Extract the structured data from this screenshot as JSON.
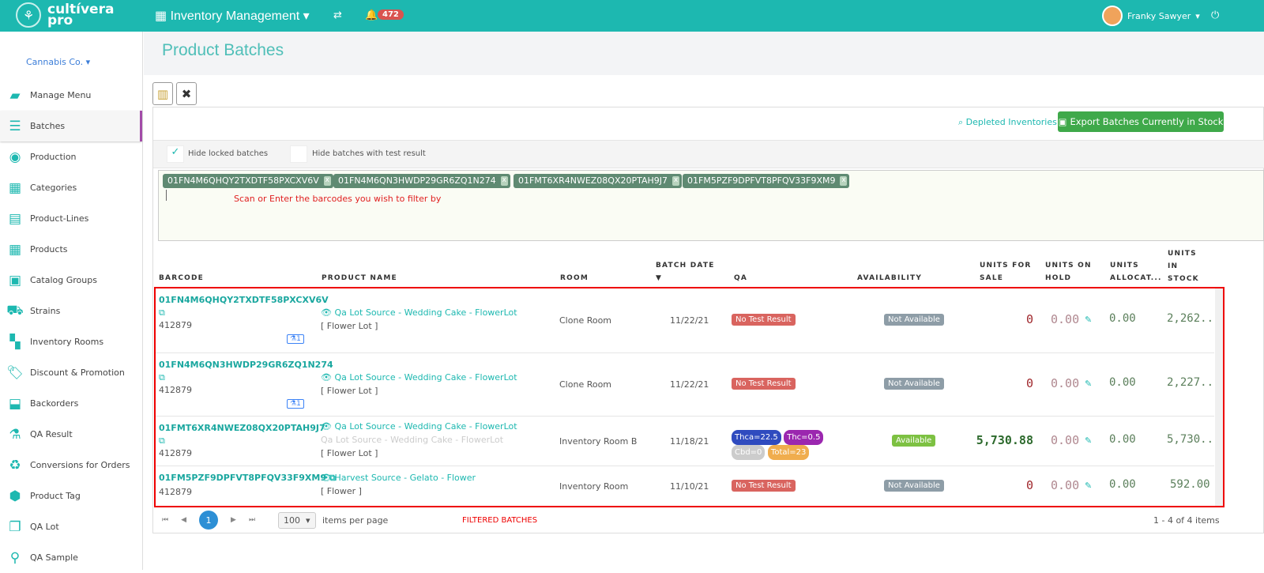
{
  "header": {
    "brand_line1": "cultívera",
    "brand_line2": "pro",
    "app_title": "Inventory Management",
    "notifications": "472",
    "user": "Franky Sawyer"
  },
  "sidebar": {
    "company": "Cannabis Co.",
    "items": [
      {
        "label": "Manage Menu",
        "icon": "▰"
      },
      {
        "label": "Batches",
        "icon": "☰"
      },
      {
        "label": "Production",
        "icon": "◉"
      },
      {
        "label": "Categories",
        "icon": "▦"
      },
      {
        "label": "Product-Lines",
        "icon": "▤"
      },
      {
        "label": "Products",
        "icon": "▦"
      },
      {
        "label": "Catalog Groups",
        "icon": "▣"
      },
      {
        "label": "Strains",
        "icon": "⛟"
      },
      {
        "label": "Inventory Rooms",
        "icon": "▚"
      },
      {
        "label": "Discount & Promotion",
        "icon": "🏷"
      },
      {
        "label": "Backorders",
        "icon": "⬓"
      },
      {
        "label": "QA Result",
        "icon": "⚗"
      },
      {
        "label": "Conversions for Orders",
        "icon": "♻"
      },
      {
        "label": "Product Tag",
        "icon": "⬢"
      },
      {
        "label": "QA Lot",
        "icon": "❐"
      },
      {
        "label": "QA Sample",
        "icon": "⚲"
      }
    ]
  },
  "page": {
    "title": "Product Batches",
    "depleted": "Depleted Inventories",
    "export": "Export Batches Currently in Stock",
    "hide_locked": "Hide locked batches",
    "hide_tested": "Hide batches with test result",
    "hint": "Scan or Enter the barcodes you wish to filter by",
    "tags": [
      "01FN4M6QHQY2TXDTF58PXCXV6V",
      "01FN4M6QN3HWDP29GR6ZQ1N274",
      "01FMT6XR4NWEZ08QX20PTAH9J7",
      "01FM5PZF9DPFVT8PFQV33F9XM9"
    ]
  },
  "table": {
    "headers": {
      "barcode": "BARCODE",
      "product": "PRODUCT NAME",
      "room": "ROOM",
      "date1": "BATCH DATE",
      "date2": "▼",
      "qa": "QA",
      "avail": "AVAILABILITY",
      "sale1": "UNITS FOR",
      "sale2": "SALE",
      "hold1": "UNITS ON",
      "hold2": "HOLD",
      "alloc1": "UNITS",
      "alloc2": "ALLOCAT...",
      "stock1": "UNITS",
      "stock2": "IN",
      "stock3": "STOCK"
    },
    "rows": [
      {
        "barcode": "01FN4M6QHQY2TXDTF58PXCXV6V",
        "id": "412879",
        "qa_count": "1",
        "product": "Qa Lot Source - Wedding Cake - FlowerLot",
        "sub": "",
        "type": "[ Flower Lot ]",
        "room": "Clone Room",
        "date": "11/22/21",
        "qa": "No Test Result",
        "avail": "Not Available",
        "sale": "0",
        "hold": "0.00",
        "alloc": "0.00",
        "stock": "2,262...."
      },
      {
        "barcode": "01FN4M6QN3HWDP29GR6ZQ1N274",
        "id": "412879",
        "qa_count": "1",
        "product": "Qa Lot Source - Wedding Cake - FlowerLot",
        "sub": "",
        "type": "[ Flower Lot ]",
        "room": "Clone Room",
        "date": "11/22/21",
        "qa": "No Test Result",
        "avail": "Not Available",
        "sale": "0",
        "hold": "0.00",
        "alloc": "0.00",
        "stock": "2,227...."
      },
      {
        "barcode": "01FMT6XR4NWEZ08QX20PTAH9J7",
        "id": "412879",
        "product": "Qa Lot Source - Wedding Cake - FlowerLot",
        "sub": "Qa Lot Source - Wedding Cake - FlowerLot",
        "type": "[ Flower Lot ]",
        "room": "Inventory Room B",
        "date": "11/18/21",
        "qa_pills": [
          "Thca=22.5",
          "Thc=0.5",
          "Cbd=0",
          "Total=23"
        ],
        "avail": "Available",
        "sale": "5,730.88",
        "hold": "0.00",
        "alloc": "0.00",
        "stock": "5,730...."
      },
      {
        "barcode": "01FM5PZF9DPFVT8PFQV33F9XM9",
        "id": "412879",
        "product": "Harvest Source - Gelato - Flower",
        "sub": "",
        "type": "[ Flower ]",
        "room": "Inventory Room",
        "date": "11/10/21",
        "qa": "No Test Result",
        "avail": "Not Available",
        "sale": "0",
        "hold": "0.00",
        "alloc": "0.00",
        "stock": "592.00"
      }
    ]
  },
  "pager": {
    "page": "1",
    "size": "100",
    "per_page": "items per page",
    "filtered": "FILTERED BATCHES",
    "summary": "1 - 4 of 4 items"
  },
  "colors": {
    "teal": "#1db8b0",
    "red": "#d9534f",
    "green": "#3fa94a"
  }
}
